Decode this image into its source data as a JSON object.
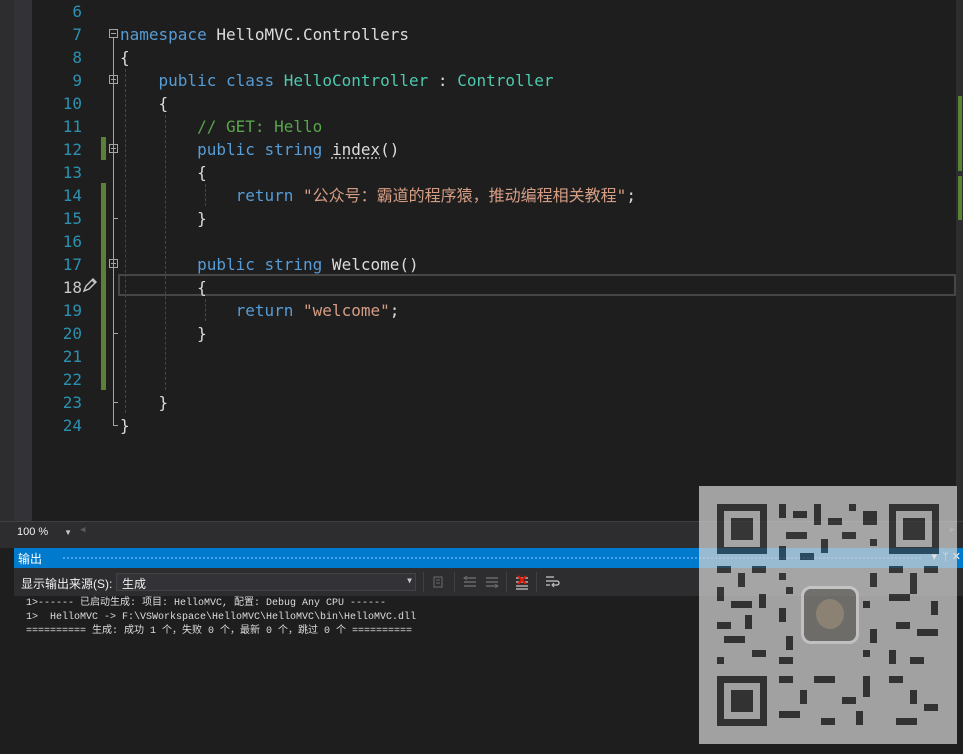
{
  "editor": {
    "line_numbers": [
      "6",
      "7",
      "8",
      "9",
      "10",
      "11",
      "12",
      "13",
      "14",
      "15",
      "16",
      "17",
      "18",
      "19",
      "20",
      "21",
      "22",
      "23",
      "24"
    ],
    "active_line": "18",
    "code_lines": [
      [],
      [
        {
          "c": "kw",
          "t": "namespace"
        },
        {
          "c": "",
          "t": " HelloMVC.Controllers"
        }
      ],
      [
        {
          "c": "",
          "t": "{"
        }
      ],
      [
        {
          "c": "",
          "t": "    "
        },
        {
          "c": "kw",
          "t": "public"
        },
        {
          "c": "",
          "t": " "
        },
        {
          "c": "kw",
          "t": "class"
        },
        {
          "c": "",
          "t": " "
        },
        {
          "c": "ty",
          "t": "HelloController"
        },
        {
          "c": "",
          "t": " : "
        },
        {
          "c": "ty",
          "t": "Controller"
        }
      ],
      [
        {
          "c": "",
          "t": "    {"
        }
      ],
      [
        {
          "c": "",
          "t": "        "
        },
        {
          "c": "cm",
          "t": "// GET: Hello"
        }
      ],
      [
        {
          "c": "",
          "t": "        "
        },
        {
          "c": "kw",
          "t": "public"
        },
        {
          "c": "",
          "t": " "
        },
        {
          "c": "kw",
          "t": "string"
        },
        {
          "c": "",
          "t": " "
        },
        {
          "c": "squig",
          "t": "index"
        },
        {
          "c": "",
          "t": "()"
        }
      ],
      [
        {
          "c": "",
          "t": "        {"
        }
      ],
      [
        {
          "c": "",
          "t": "            "
        },
        {
          "c": "kw",
          "t": "return"
        },
        {
          "c": "",
          "t": " "
        },
        {
          "c": "st",
          "t": "\"公众号：霸道的程序猿，推动编程相关教程\""
        },
        {
          "c": "",
          "t": ";"
        }
      ],
      [
        {
          "c": "",
          "t": "        }"
        }
      ],
      [],
      [
        {
          "c": "",
          "t": "        "
        },
        {
          "c": "kw",
          "t": "public"
        },
        {
          "c": "",
          "t": " "
        },
        {
          "c": "kw",
          "t": "string"
        },
        {
          "c": "",
          "t": " Welcome()"
        }
      ],
      [
        {
          "c": "",
          "t": "        {"
        }
      ],
      [
        {
          "c": "",
          "t": "            "
        },
        {
          "c": "kw",
          "t": "return"
        },
        {
          "c": "",
          "t": " "
        },
        {
          "c": "st",
          "t": "\"welcome\""
        },
        {
          "c": "",
          "t": ";"
        }
      ],
      [
        {
          "c": "",
          "t": "        }"
        }
      ],
      [],
      [],
      [
        {
          "c": "",
          "t": "    }"
        }
      ],
      [
        {
          "c": "",
          "t": "}"
        }
      ]
    ],
    "colors": {
      "keyword": "#569cd6",
      "type": "#4ec9b0",
      "comment": "#57a64a",
      "string": "#d69d85",
      "line_number": "#2b91af",
      "change_bar": "#5a8136"
    }
  },
  "zoom": {
    "value": "100 %"
  },
  "output_panel": {
    "title": "输出",
    "source_label": "显示输出来源(S):",
    "source_value": "生成",
    "lines": [
      "1>------ 已启动生成: 项目: HelloMVC, 配置: Debug Any CPU ------",
      "1>  HelloMVC -> F:\\VSWorkspace\\HelloMVC\\HelloMVC\\bin\\HelloMVC.dll",
      "========== 生成: 成功 1 个，失败 0 个，最新 0 个，跳过 0 个 =========="
    ],
    "title_controls": [
      "▾",
      "ᛘ",
      "✕"
    ],
    "accent": "#007acc"
  }
}
